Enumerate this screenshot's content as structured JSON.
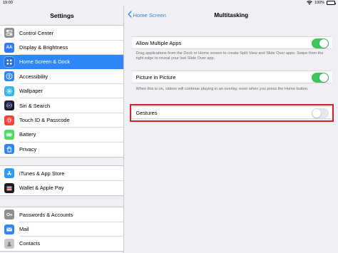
{
  "status_bar": {
    "time": "19:00",
    "battery_text": "100%"
  },
  "sidebar": {
    "title": "Settings",
    "groups": [
      {
        "items": [
          {
            "label": "Control Center",
            "icon": "control-center-icon",
            "color": "#8e8e93"
          },
          {
            "label": "Display & Brightness",
            "icon": "display-brightness-icon",
            "color": "#2f7cf6",
            "glyph": "AA"
          },
          {
            "label": "Home Screen & Dock",
            "icon": "home-screen-icon",
            "color": "#2f86f6",
            "selected": true
          },
          {
            "label": "Accessibility",
            "icon": "accessibility-icon",
            "color": "#2f86f6"
          },
          {
            "label": "Wallpaper",
            "icon": "wallpaper-icon",
            "color": "#38b6e8"
          },
          {
            "label": "Siri & Search",
            "icon": "siri-icon",
            "color": "#222233"
          },
          {
            "label": "Touch ID & Passcode",
            "icon": "fingerprint-icon",
            "color": "#f2453d"
          },
          {
            "label": "Battery",
            "icon": "battery-icon",
            "color": "#4cd964"
          },
          {
            "label": "Privacy",
            "icon": "privacy-hand-icon",
            "color": "#2f86f6"
          }
        ]
      },
      {
        "items": [
          {
            "label": "iTunes & App Store",
            "icon": "app-store-icon",
            "color": "#2f9bf6"
          },
          {
            "label": "Wallet & Apple Pay",
            "icon": "wallet-icon",
            "color": "#1c1c1e"
          }
        ]
      },
      {
        "items": [
          {
            "label": "Passwords & Accounts",
            "icon": "key-icon",
            "color": "#8e8e93"
          },
          {
            "label": "Mail",
            "icon": "mail-icon",
            "color": "#2f86f6"
          },
          {
            "label": "Contacts",
            "icon": "contacts-icon",
            "color": "#a2a2a8"
          }
        ]
      }
    ]
  },
  "detail": {
    "back_label": "Home Screen",
    "title": "Multitasking",
    "settings": [
      {
        "label": "Allow Multiple Apps",
        "on": true,
        "footer": "Drag applications from the Dock or Home screen to create Split View and Slide Over apps. Swipe from the right edge to reveal your last Slide Over app."
      },
      {
        "label": "Picture in Picture",
        "on": true,
        "footer": "When this is on, videos will continue playing in an overlay, even when you press the Home button."
      },
      {
        "label": "Gestures",
        "on": false,
        "footer": ""
      }
    ],
    "colors": {
      "accent": "#2f86f6",
      "toggle_on": "#3fc35b",
      "highlight": "#d81f26"
    }
  }
}
